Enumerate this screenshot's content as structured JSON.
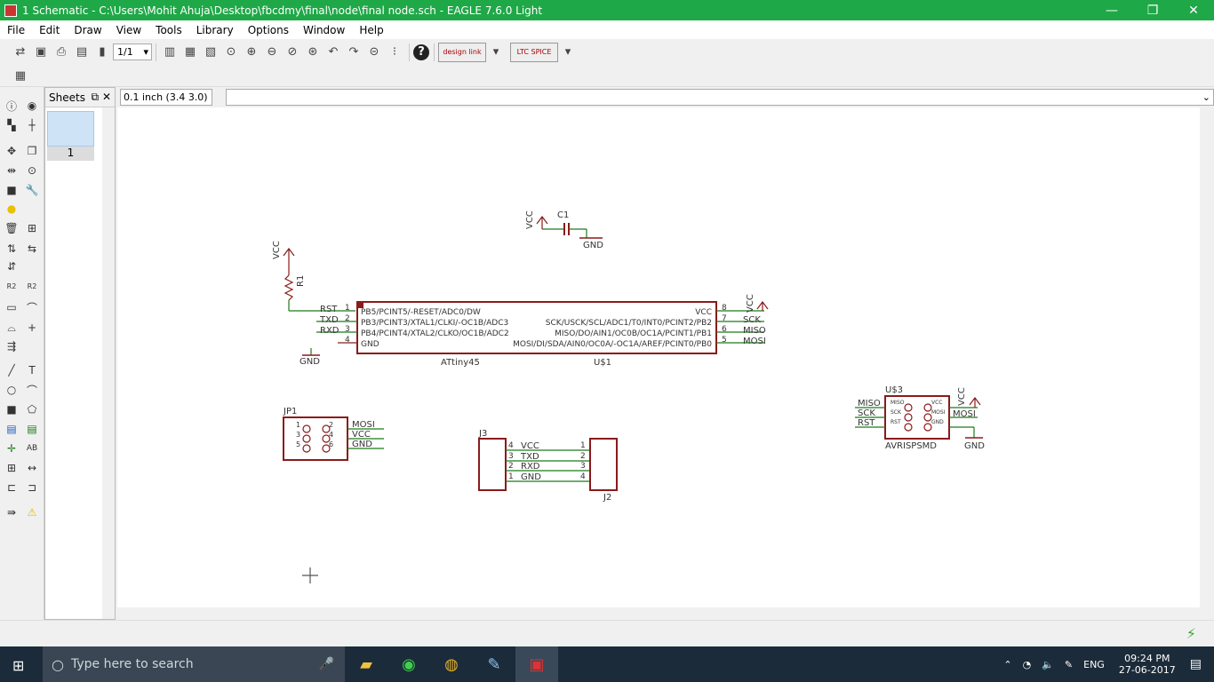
{
  "window": {
    "title": "1 Schematic - C:\\Users\\Mohit Ahuja\\Desktop\\fbcdmy\\final\\node\\final node.sch - EAGLE 7.6.0 Light",
    "minimize": "—",
    "restore": "❐",
    "close": "✕"
  },
  "menu": [
    "File",
    "Edit",
    "Draw",
    "View",
    "Tools",
    "Library",
    "Options",
    "Window",
    "Help"
  ],
  "toolbar": {
    "sheet_select": "1/1",
    "help": "?",
    "designlink_label": "design link",
    "ltspice_label": "LTC SPICE"
  },
  "sheets_panel": {
    "title": "Sheets",
    "sheet_number": "1"
  },
  "coord": {
    "grid_readout": "0.1 inch (3.4 3.0)"
  },
  "schematic": {
    "c1": {
      "name": "C1",
      "vcc": "VCC",
      "gnd": "GND"
    },
    "r1": {
      "name": "R1",
      "vcc": "VCC"
    },
    "ic": {
      "name": "ATtiny45",
      "ref": "U$1",
      "gnd_label": "GND",
      "vcc_label": "VCC",
      "left_pins": [
        {
          "num": "1",
          "net": "RST",
          "func": "PB5/PCINT5/-RESET/ADC0/DW"
        },
        {
          "num": "2",
          "net": "TXD",
          "func": "PB3/PCINT3/XTAL1/CLKI/-OC1B/ADC3"
        },
        {
          "num": "3",
          "net": "RXD",
          "func": "PB4/PCINT4/XTAL2/CLKO/OC1B/ADC2"
        },
        {
          "num": "4",
          "net": "",
          "func": "GND"
        }
      ],
      "right_pins": [
        {
          "num": "8",
          "net": "",
          "func": "VCC"
        },
        {
          "num": "7",
          "net": "SCK",
          "func": "SCK/USCK/SCL/ADC1/T0/INT0/PCINT2/PB2"
        },
        {
          "num": "6",
          "net": "MISO",
          "func": "MISO/DO/AIN1/OC0B/OC1A/PCINT1/PB1"
        },
        {
          "num": "5",
          "net": "MOSI",
          "func": "MOSI/DI/SDA/AIN0/OC0A/-OC1A/AREF/PCINT0/PB0"
        }
      ]
    },
    "jp1": {
      "name": "JP1",
      "pins": [
        "1",
        "2",
        "3",
        "4",
        "5",
        "6"
      ],
      "nets": [
        "MOSI",
        "VCC",
        "GND"
      ]
    },
    "j3": {
      "name": "J3",
      "pins": [
        "4",
        "3",
        "2",
        "1"
      ],
      "nets": [
        "VCC",
        "TXD",
        "RXD",
        "GND"
      ]
    },
    "j2": {
      "name": "J2",
      "pins": [
        "1",
        "2",
        "3",
        "4"
      ]
    },
    "u3": {
      "name": "U$3",
      "value": "AVRISPSMD",
      "left_nets": [
        "MISO",
        "SCK",
        "RST"
      ],
      "inner_left": [
        "MISO",
        "SCK",
        "RST"
      ],
      "inner_right": [
        "VCC",
        "MOSI",
        "GND"
      ],
      "right_nets": [
        "VCC",
        "MOSI",
        "GND"
      ]
    }
  },
  "taskbar": {
    "search_placeholder": "Type here to search",
    "lang": "ENG",
    "time": "09:24 PM",
    "date": "27-06-2017"
  },
  "colors": {
    "titlebar": "#1fa847",
    "symbol": "#8b1a1a",
    "net": "#1a7a1a",
    "taskbar": "#1c2b39"
  }
}
